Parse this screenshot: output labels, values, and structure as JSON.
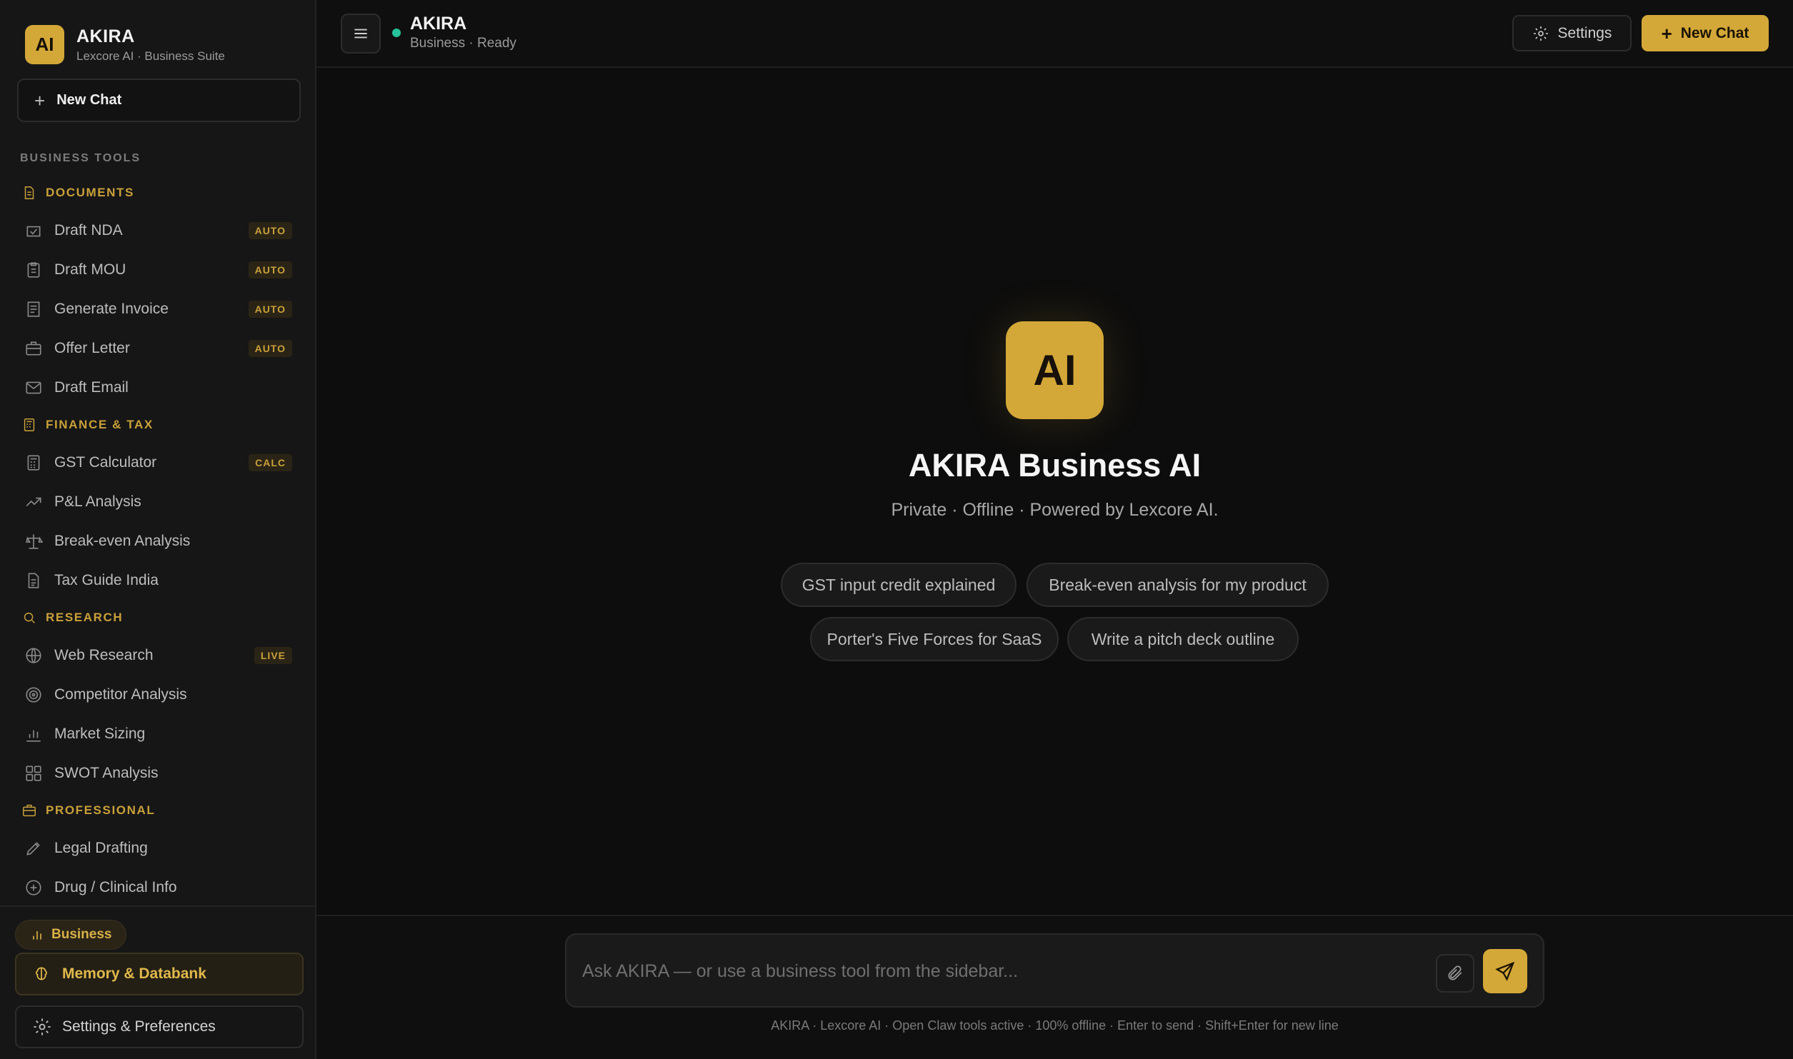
{
  "brand": {
    "logo": "AI",
    "title": "AKIRA",
    "subtitle": "Lexcore AI · Business Suite"
  },
  "sidebar": {
    "new_chat": "New Chat",
    "tools_label": "BUSINESS TOOLS",
    "sections": [
      {
        "title": "DOCUMENTS",
        "icon": "document-icon",
        "items": [
          {
            "label": "Draft NDA",
            "badge": "AUTO",
            "icon": "shield-check-icon"
          },
          {
            "label": "Draft MOU",
            "badge": "AUTO",
            "icon": "clipboard-icon"
          },
          {
            "label": "Generate Invoice",
            "badge": "AUTO",
            "icon": "receipt-icon"
          },
          {
            "label": "Offer Letter",
            "badge": "AUTO",
            "icon": "briefcase-icon"
          },
          {
            "label": "Draft Email",
            "badge": "",
            "icon": "mail-icon"
          }
        ]
      },
      {
        "title": "FINANCE & TAX",
        "icon": "calculator-icon",
        "items": [
          {
            "label": "GST Calculator",
            "badge": "CALC",
            "icon": "calculator-icon"
          },
          {
            "label": "P&L Analysis",
            "badge": "",
            "icon": "trending-up-icon"
          },
          {
            "label": "Break-even Analysis",
            "badge": "",
            "icon": "scale-icon"
          },
          {
            "label": "Tax Guide India",
            "badge": "",
            "icon": "file-text-icon"
          }
        ]
      },
      {
        "title": "RESEARCH",
        "icon": "search-icon",
        "items": [
          {
            "label": "Web Research",
            "badge": "LIVE",
            "icon": "globe-icon"
          },
          {
            "label": "Competitor Analysis",
            "badge": "",
            "icon": "target-icon"
          },
          {
            "label": "Market Sizing",
            "badge": "",
            "icon": "bar-chart-icon"
          },
          {
            "label": "SWOT Analysis",
            "badge": "",
            "icon": "grid-icon"
          }
        ]
      },
      {
        "title": "PROFESSIONAL",
        "icon": "briefcase-icon",
        "items": [
          {
            "label": "Legal Drafting",
            "badge": "",
            "icon": "pen-icon"
          },
          {
            "label": "Drug / Clinical Info",
            "badge": "",
            "icon": "plus-circle-icon"
          }
        ]
      }
    ],
    "mode_chip": "Business",
    "memory_button": "Memory & Databank",
    "preferences_button": "Settings & Preferences"
  },
  "header": {
    "title": "AKIRA",
    "subtitle": "Business · Ready",
    "settings_label": "Settings",
    "new_chat_label": "New Chat"
  },
  "hero": {
    "logo": "AI",
    "title": "AKIRA Business AI",
    "subtitle": "Private · Offline · Powered by Lexcore AI.",
    "suggestions": [
      "GST input credit explained",
      "Break-even analysis for my product",
      "Porter's Five Forces for SaaS",
      "Write a pitch deck outline"
    ]
  },
  "composer": {
    "placeholder": "Ask AKIRA — or use a business tool from the sidebar...",
    "value": ""
  },
  "footer": {
    "note": "AKIRA · Lexcore AI · Open Claw tools active · 100% offline · Enter to send · Shift+Enter for new line"
  },
  "colors": {
    "accent": "#d4a838",
    "status": "#26c29a",
    "background": "#0d0d0d",
    "sidebar": "#161616"
  }
}
